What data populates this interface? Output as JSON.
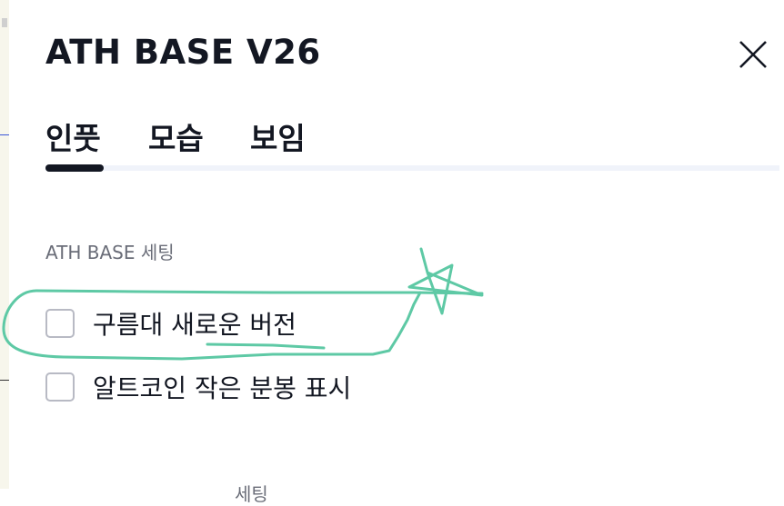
{
  "dialog": {
    "title": "ATH BASE V26",
    "close_icon": "close-icon"
  },
  "tabs": [
    {
      "label": "인풋",
      "active": true
    },
    {
      "label": "모습",
      "active": false
    },
    {
      "label": "보임",
      "active": false
    }
  ],
  "section": {
    "label": "ATH BASE 세팅"
  },
  "options": [
    {
      "label": "구름대 새로운 버전",
      "checked": false
    },
    {
      "label": "알트코인 작은 분봉 표시",
      "checked": false
    }
  ],
  "next_section": {
    "partial_label": "세팅"
  },
  "colors": {
    "text": "#131722",
    "muted": "#6a6d78",
    "annotation": "#5ec9a5",
    "checkbox_border": "#b8bac4"
  }
}
